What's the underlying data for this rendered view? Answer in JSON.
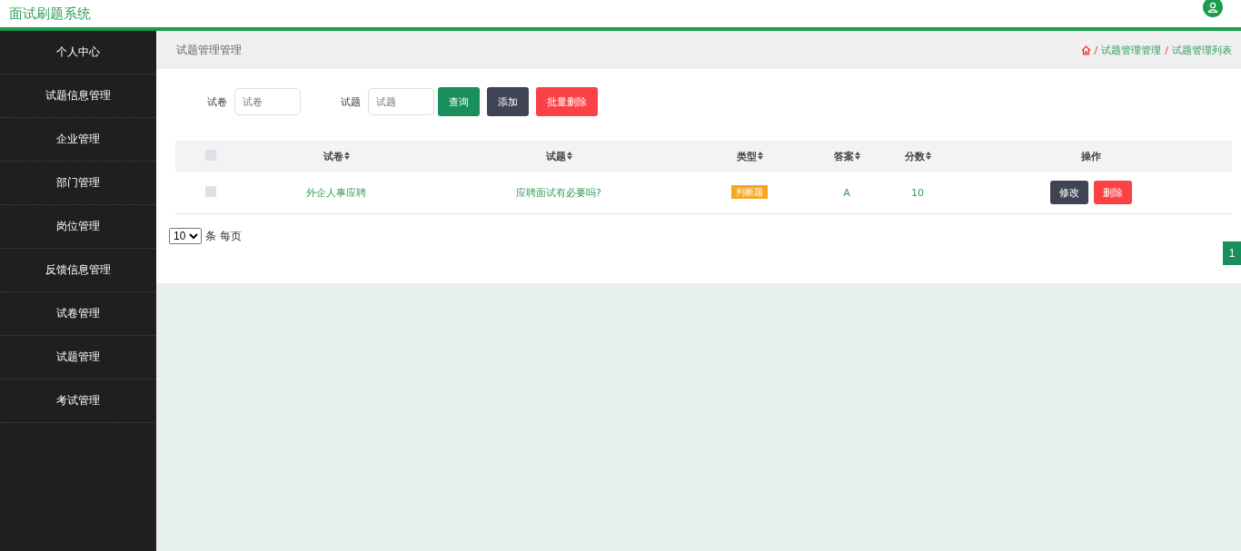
{
  "header": {
    "title": "面试刷题系统"
  },
  "sidebar": {
    "items": [
      {
        "label": "个人中心"
      },
      {
        "label": "试题信息管理"
      },
      {
        "label": "企业管理"
      },
      {
        "label": "部门管理"
      },
      {
        "label": "岗位管理"
      },
      {
        "label": "反馈信息管理"
      },
      {
        "label": "试卷管理"
      },
      {
        "label": "试题管理"
      },
      {
        "label": "考试管理"
      }
    ]
  },
  "page_title": "试题管理管理",
  "breadcrumb": {
    "separator": "/",
    "items": [
      "试题管理管理",
      "试题管理列表"
    ]
  },
  "search": {
    "fields": [
      {
        "label": "试卷",
        "placeholder": "试卷"
      },
      {
        "label": "试题",
        "placeholder": "试题"
      }
    ],
    "buttons": [
      {
        "label": "查询",
        "kind": "search"
      },
      {
        "label": "添加",
        "kind": "add"
      },
      {
        "label": "批量删除",
        "kind": "delete"
      }
    ]
  },
  "table": {
    "all_checked": false,
    "columns": [
      {
        "label": "试卷",
        "sortable": true
      },
      {
        "label": "试题",
        "sortable": true
      },
      {
        "label": "类型",
        "sortable": true
      },
      {
        "label": "答案",
        "sortable": true
      },
      {
        "label": "分数",
        "sortable": true
      },
      {
        "label": "操作",
        "sortable": false
      }
    ],
    "rows": [
      {
        "checked": false,
        "paper": "外企人事应聘",
        "question": "应聘面试有必要吗?",
        "type": "判断题",
        "answer": "A",
        "score": "10",
        "actions": [
          {
            "label": "修改",
            "kind": "edit"
          },
          {
            "label": "删除",
            "kind": "delete"
          }
        ]
      }
    ]
  },
  "pagination": {
    "page_size": "10",
    "page_size_label": "条 每页",
    "pages": [
      {
        "label": "1",
        "selected": true
      }
    ]
  }
}
